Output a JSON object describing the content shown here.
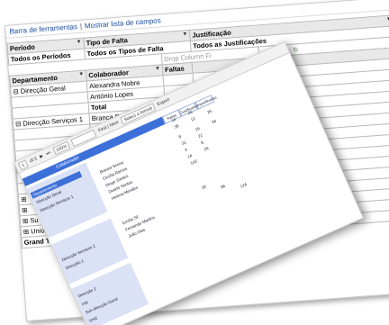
{
  "toolbar": {
    "bar_label": "Barra de ferramentas",
    "separator": "|",
    "field_list_label": "Mostrar lista de campos"
  },
  "filters": {
    "periodo_label": "Período",
    "tipo_falta_label": "Tipo de Falta",
    "justificacao_label": "Justificação",
    "periodo_value": "Todos os Períodos",
    "tipo_falta_value": "Todos os Tipos de Falta",
    "justificacao_value": "Todos as Justificações",
    "drop_column": "Drop Column Fi"
  },
  "grid": {
    "col_departamento": "Departamento",
    "col_colaborador": "Colaborador",
    "col_faltas": "Faltas",
    "rows": [
      {
        "dept": "⊟ Direcção Geral",
        "colab": "Alexandra Nobre"
      },
      {
        "dept": "",
        "colab": "António Lopes"
      },
      {
        "dept": "",
        "colab": "Total"
      },
      {
        "dept": "⊟ Direcção Serviços 1",
        "colab": "Branca S"
      }
    ],
    "lower_rows": [
      "⊞ ",
      "⊞ ",
      "⊞ Su",
      "⊞ Unid"
    ],
    "grand_total": "Grand T",
    "cut_text": "ls"
  },
  "report": {
    "page_field": "1",
    "page_of": "of 3",
    "zoom": "100%",
    "find_btn": "Find | Next",
    "select_fmt": "Select a format",
    "export_btn": "Export",
    "header_title": "Colaborador",
    "header_cells": [
      "Faltas",
      "Justificadas",
      "Injustificadas"
    ],
    "bands": [
      "Direcção Geral",
      "Direcção Serviços 1",
      "Direcção Serviços 2",
      "Direcção 1"
    ],
    "band_bar": "Departamento",
    "names": [
      "Branca Sousa",
      "Cecília Ramos",
      "Diogo Santos",
      "Duarte Santos",
      "Helena Mendes",
      "Emília Sil",
      "Fernando Martins",
      "João Dias"
    ],
    "bottom_labels": [
      "Direcção 2",
      "Info",
      "Sub-direcção Geral",
      "Unid"
    ],
    "numbers": [
      "14",
      "25",
      "36",
      "12",
      "25",
      "8",
      "16",
      "34",
      "31",
      "21",
      "3",
      "8",
      "14",
      "26",
      "143",
      "18",
      "96",
      "124"
    ]
  }
}
